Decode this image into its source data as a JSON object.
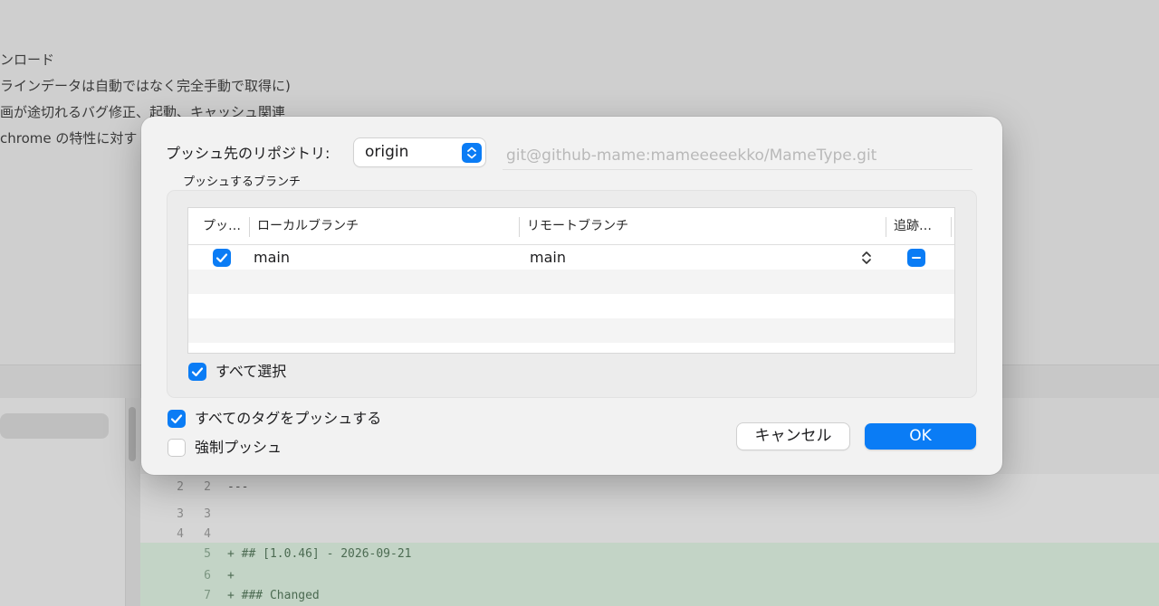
{
  "background": {
    "notes": [
      "ンロード",
      "ラインデータは自動ではなく完全手動で取得に)",
      "画が途切れるバグ修正、起動、キャッシュ関連",
      "chrome の特性に対す"
    ],
    "diff_lines": [
      {
        "old": "2",
        "new": "2",
        "text": "---",
        "added": false
      },
      {
        "old": "3",
        "new": "3",
        "text": "",
        "added": false
      },
      {
        "old": "4",
        "new": "4",
        "text": "",
        "added": false
      },
      {
        "old": "",
        "new": "5",
        "text": "+ ## [1.0.46] - 2026-09-21",
        "added": true
      },
      {
        "old": "",
        "new": "6",
        "text": "+",
        "added": true
      },
      {
        "old": "",
        "new": "7",
        "text": "+ ### Changed",
        "added": true
      }
    ]
  },
  "dialog": {
    "repo_label": "プッシュ先のリポジトリ:",
    "repo_value": "origin",
    "repo_url": "git@github-mame:mameeeeekko/MameType.git",
    "branches_title": "プッシュするブランチ",
    "columns": {
      "push": "プッ…",
      "local": "ローカルブランチ",
      "remote": "リモートブランチ",
      "track": "追跡…"
    },
    "rows": [
      {
        "push": true,
        "local": "main",
        "remote": "main",
        "track": "mixed"
      }
    ],
    "select_all_label": "すべて選択",
    "select_all_checked": true,
    "push_all_tags_label": "すべてのタグをプッシュする",
    "push_all_tags_checked": true,
    "force_push_label": "強制プッシュ",
    "force_push_checked": false,
    "cancel_label": "キャンセル",
    "ok_label": "OK"
  },
  "colors": {
    "accent": "#0a7cf5",
    "dim_background": "#cfcfcf",
    "sheet": "#f2f2f2"
  },
  "icons": {
    "repo_stepper": "up-down-chevron-icon",
    "remote_stepper": "up-down-chevron-icon",
    "checkbox": "checkmark-icon",
    "track_mixed": "minus-icon"
  }
}
